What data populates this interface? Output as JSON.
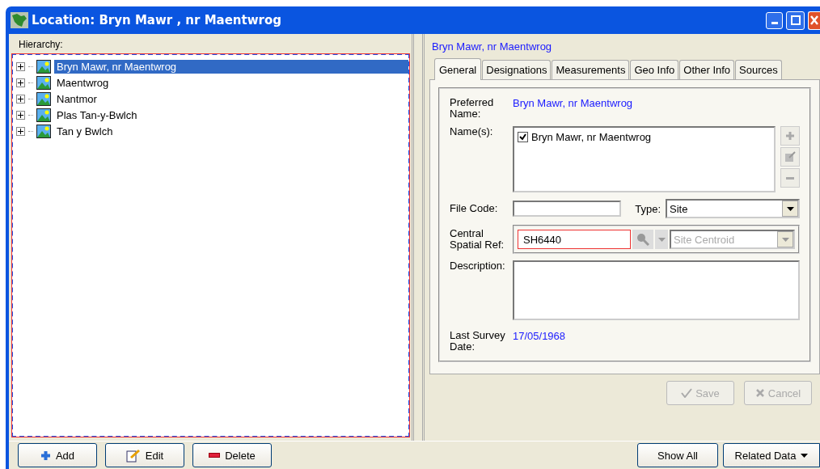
{
  "window": {
    "title": "Location: Bryn Mawr , nr Maentwrog"
  },
  "hierarchy": {
    "label": "Hierarchy:",
    "items": [
      {
        "label": "Bryn Mawr, nr Maentwrog",
        "selected": true,
        "expanded": false
      },
      {
        "label": "Maentwrog",
        "selected": false,
        "expanded": false
      },
      {
        "label": "Nantmor",
        "selected": false,
        "expanded": false
      },
      {
        "label": "Plas Tan-y-Bwlch",
        "selected": false,
        "expanded": false
      },
      {
        "label": "Tan y Bwlch",
        "selected": false,
        "expanded": false
      }
    ]
  },
  "detail": {
    "heading": "Bryn Mawr, nr Maentwrog",
    "tabs": [
      {
        "label": "General",
        "selected": true
      },
      {
        "label": "Designations",
        "selected": false
      },
      {
        "label": "Measurements",
        "selected": false
      },
      {
        "label": "Geo Info",
        "selected": false
      },
      {
        "label": "Other Info",
        "selected": false
      },
      {
        "label": "Sources",
        "selected": false
      }
    ],
    "preferred_name": {
      "label": "Preferred Name:",
      "value": "Bryn Mawr, nr Maentwrog"
    },
    "names": {
      "label": "Name(s):",
      "items": [
        {
          "label": "Bryn Mawr, nr Maentwrog",
          "checked": true
        }
      ]
    },
    "file_code": {
      "label": "File Code:"
    },
    "type": {
      "label": "Type:",
      "value": "Site"
    },
    "spatial_ref": {
      "label": "Central Spatial Ref:",
      "value": "SH6440",
      "system": "Site Centroid"
    },
    "description": {
      "label": "Description:"
    },
    "last_survey": {
      "label": "Last Survey Date:",
      "value": "17/05/1968"
    },
    "actions": [
      {
        "label": "Save",
        "kind": "save",
        "disabled": true
      },
      {
        "label": "Cancel",
        "kind": "cancel",
        "disabled": true
      }
    ]
  },
  "bottom_left_buttons": [
    {
      "label": "Add",
      "kind": "add"
    },
    {
      "label": "Edit",
      "kind": "edit"
    },
    {
      "label": "Delete",
      "kind": "delete"
    }
  ],
  "bottom_right_buttons": [
    {
      "label": "Show All",
      "kind": "plain"
    },
    {
      "label": "Related Data",
      "kind": "menu"
    }
  ]
}
